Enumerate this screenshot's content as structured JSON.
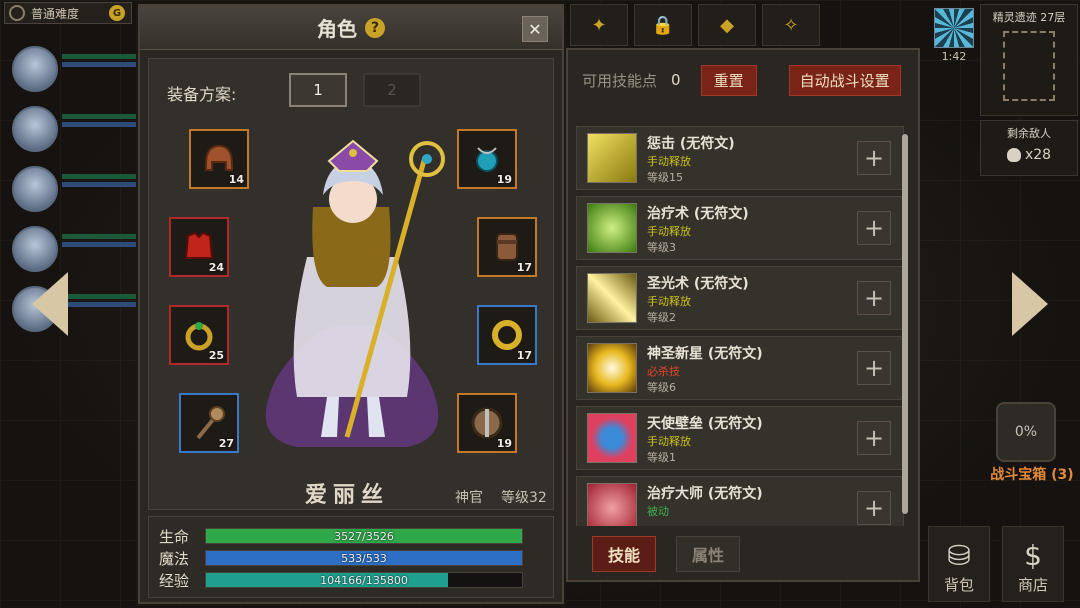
{
  "colors": {
    "accent_red": "#7a2418",
    "hp": "#2fa84a",
    "mp": "#2d6fc4",
    "xp": "#1fa08e",
    "manual": "#c9c21e",
    "ultimate": "#e0452c",
    "passive": "#3fb14a"
  },
  "difficulty": {
    "label": "普通难度",
    "icon": "gear-icon"
  },
  "top": {
    "timer": "1:42",
    "dungeon_name": "精灵遗迹 27层",
    "enemies_label": "剩余敌人",
    "enemies_count": "x28"
  },
  "chest": {
    "percent": "0%",
    "label": "战斗宝箱 (3)"
  },
  "bottom_buttons": [
    {
      "label": "背包",
      "icon": "bag-icon"
    },
    {
      "label": "商店",
      "icon": "dollar-icon"
    }
  ],
  "character_panel": {
    "title": "角色",
    "help_symbol": "?",
    "close_symbol": "✕",
    "equip_plan_label": "装备方案:",
    "plans": [
      "1",
      "2"
    ],
    "active_plan": "1",
    "equipment": [
      {
        "slot": "helmet",
        "level": "14",
        "icon": "helmet-icon"
      },
      {
        "slot": "amulet",
        "level": "19",
        "icon": "amulet-icon"
      },
      {
        "slot": "armor",
        "level": "24",
        "icon": "armor-icon"
      },
      {
        "slot": "gloves",
        "level": "17",
        "icon": "gloves-icon"
      },
      {
        "slot": "ring-1",
        "level": "25",
        "icon": "ring-icon"
      },
      {
        "slot": "ring-2",
        "level": "17",
        "icon": "ring-icon"
      },
      {
        "slot": "weapon",
        "level": "27",
        "icon": "staff-icon"
      },
      {
        "slot": "shield",
        "level": "19",
        "icon": "shield-icon"
      }
    ],
    "name": "爱丽丝",
    "class": "神官",
    "level": "等级32",
    "stats": [
      {
        "label": "生命",
        "text": "3527/3526",
        "fill": 1.0
      },
      {
        "label": "魔法",
        "text": "533/533",
        "fill": 1.0
      },
      {
        "label": "经验",
        "text": "104166/135800",
        "fill": 0.767
      }
    ]
  },
  "skill_panel": {
    "available_label": "可用技能点",
    "available_points": "0",
    "reset_label": "重置",
    "auto_label": "自动战斗设置",
    "skills": [
      {
        "name": "惩击 (无符文)",
        "type": "手动释放",
        "type_kind": "manual",
        "level": "等级15",
        "icon": "smite-icon"
      },
      {
        "name": "治疗术 (无符文)",
        "type": "手动释放",
        "type_kind": "manual",
        "level": "等级3",
        "icon": "heal-icon"
      },
      {
        "name": "圣光术 (无符文)",
        "type": "手动释放",
        "type_kind": "manual",
        "level": "等级2",
        "icon": "holy-light-icon"
      },
      {
        "name": "神圣新星 (无符文)",
        "type": "必杀技",
        "type_kind": "ultimate",
        "level": "等级6",
        "icon": "holy-nova-icon"
      },
      {
        "name": "天使壁垒 (无符文)",
        "type": "手动释放",
        "type_kind": "manual",
        "level": "等级1",
        "icon": "angel-barrier-icon"
      },
      {
        "name": "治疗大师 (无符文)",
        "type": "被动",
        "type_kind": "passive",
        "level": "",
        "icon": "heal-master-icon"
      }
    ],
    "tabs": [
      "技能",
      "属性"
    ],
    "active_tab": "技能"
  }
}
